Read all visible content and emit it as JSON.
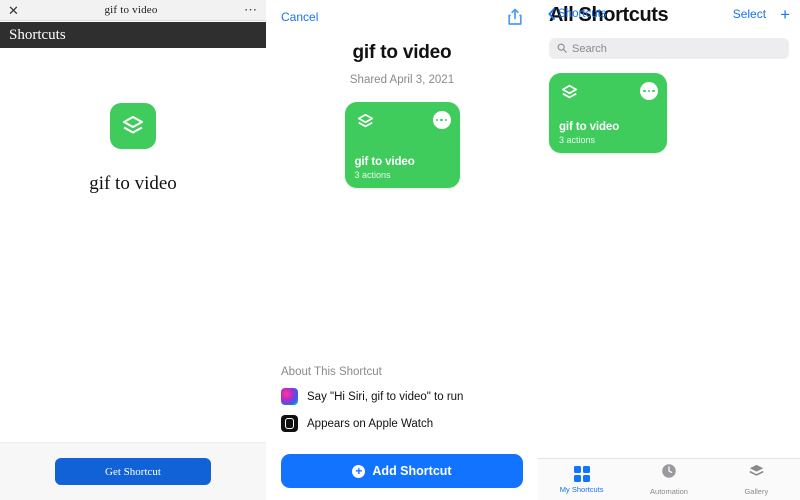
{
  "theme": {
    "green": "#3fcc5c",
    "blue": "#1273ff",
    "link_blue": "#1874f0",
    "gray_text": "#8a8a8e",
    "dark_bar": "#2f2f2f"
  },
  "panel_left": {
    "browser": {
      "close_icon": "close-icon",
      "title": "gif to video",
      "menu_icon": "more-horizontal-icon"
    },
    "app_bar_label": "Shortcuts",
    "shortcut_icon": "layers-icon",
    "shortcut_name": "gif to video",
    "get_button_label": "Get Shortcut"
  },
  "panel_mid": {
    "cancel_label": "Cancel",
    "share_icon": "share-icon",
    "title": "gif to video",
    "shared_date": "Shared April 3, 2021",
    "card": {
      "icon": "layers-icon",
      "menu_icon": "more-horizontal-icon",
      "name": "gif to video",
      "actions": "3 actions"
    },
    "about_heading": "About This Shortcut",
    "about_rows": [
      {
        "icon": "siri-icon",
        "text": "Say \"Hi Siri, gif to video\" to run"
      },
      {
        "icon": "apple-watch-icon",
        "text": "Appears on Apple Watch"
      }
    ],
    "add_button_label": "Add Shortcut",
    "add_button_icon": "plus-circle-icon"
  },
  "panel_right": {
    "back_label": "Shortcuts",
    "back_icon": "chevron-left-icon",
    "select_label": "Select",
    "add_icon": "plus-icon",
    "title": "All Shortcuts",
    "search_placeholder": "Search",
    "search_icon": "search-icon",
    "search_value": "",
    "card": {
      "icon": "layers-icon",
      "menu_icon": "more-horizontal-icon",
      "name": "gif to video",
      "actions": "3 actions"
    },
    "tabs": [
      {
        "label": "My Shortcuts",
        "icon": "grid-icon",
        "active": true
      },
      {
        "label": "Automation",
        "icon": "clock-icon",
        "active": false
      },
      {
        "label": "Gallery",
        "icon": "layers-icon",
        "active": false
      }
    ]
  }
}
